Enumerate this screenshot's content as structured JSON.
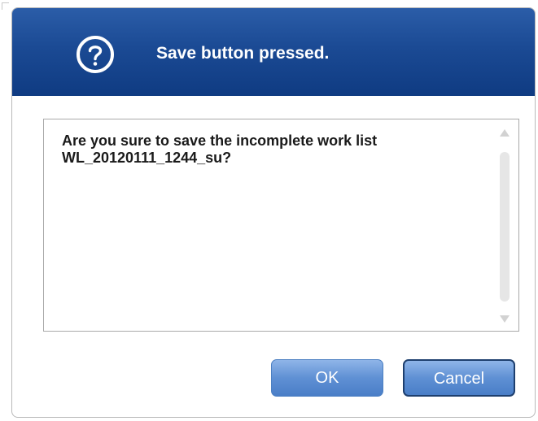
{
  "dialog": {
    "title": "Save button pressed.",
    "icon": "question-circle-icon",
    "message": "Are you sure to save the incomplete work list WL_20120111_1244_su?",
    "buttons": {
      "ok_label": "OK",
      "cancel_label": "Cancel"
    }
  },
  "colors": {
    "title_bar": "#1b4a94",
    "button": "#5f90d4",
    "button_text": "#ffffff"
  }
}
